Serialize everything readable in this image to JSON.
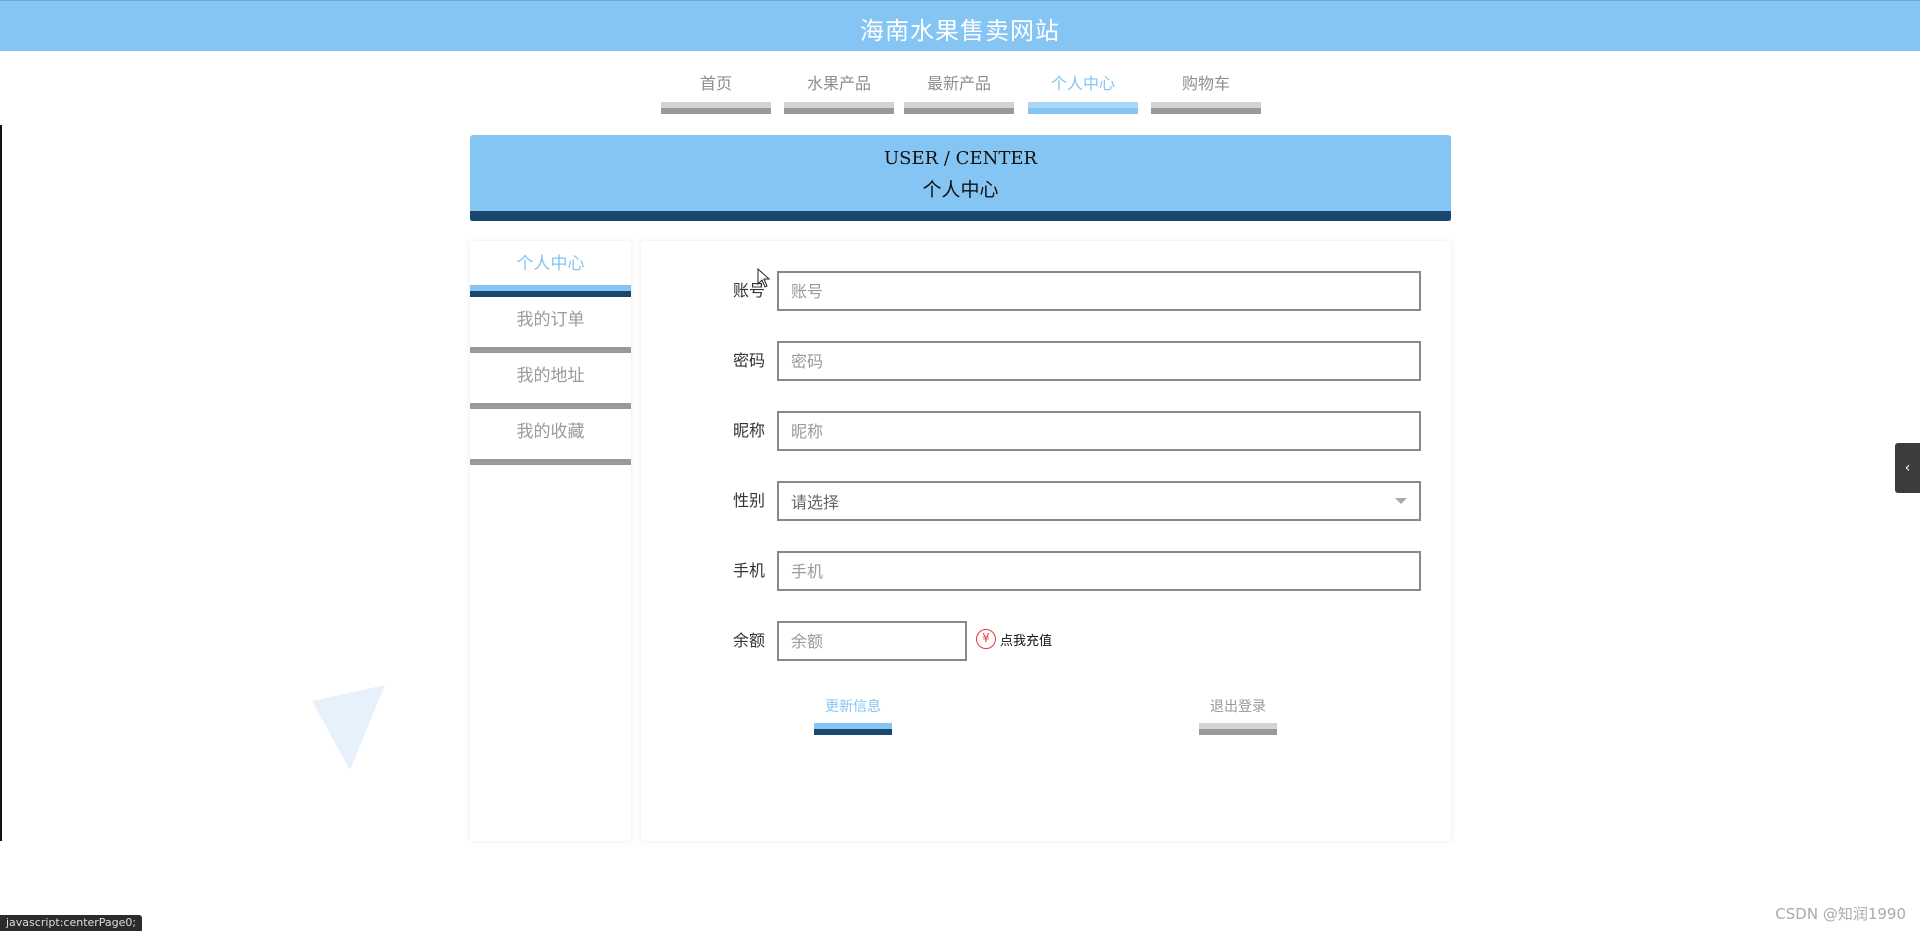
{
  "site": {
    "title": "海南水果售卖网站"
  },
  "nav": {
    "items": [
      {
        "label": "首页",
        "active": false
      },
      {
        "label": "水果产品",
        "active": false
      },
      {
        "label": "最新产品",
        "active": false
      },
      {
        "label": "个人中心",
        "active": true
      },
      {
        "label": "购物车",
        "active": false
      }
    ]
  },
  "banner": {
    "en": "USER / CENTER",
    "cn": "个人中心"
  },
  "sidebar": {
    "items": [
      {
        "label": "个人中心",
        "active": true
      },
      {
        "label": "我的订单",
        "active": false
      },
      {
        "label": "我的地址",
        "active": false
      },
      {
        "label": "我的收藏",
        "active": false
      }
    ]
  },
  "form": {
    "account": {
      "label": "账号",
      "placeholder": "账号",
      "value": ""
    },
    "password": {
      "label": "密码",
      "placeholder": "密码",
      "value": ""
    },
    "nickname": {
      "label": "昵称",
      "placeholder": "昵称",
      "value": ""
    },
    "gender": {
      "label": "性别",
      "selected": "请选择"
    },
    "phone": {
      "label": "手机",
      "placeholder": "手机",
      "value": ""
    },
    "balance": {
      "label": "余额",
      "placeholder": "余额",
      "value": ""
    },
    "recharge": {
      "symbol": "¥",
      "label": "点我充值"
    },
    "update_button": "更新信息",
    "logout_button": "退出登录"
  },
  "colors": {
    "primary": "#85c5f3",
    "dark_accent": "#1a4770",
    "inactive_text": "#9a9a9a",
    "recharge_red": "#e53b3b"
  },
  "statusbar": {
    "text": "javascript:centerPage0;"
  },
  "watermark": {
    "text": "CSDN @知润1990"
  },
  "side_toggle": {
    "icon": "chevron-left-icon"
  }
}
